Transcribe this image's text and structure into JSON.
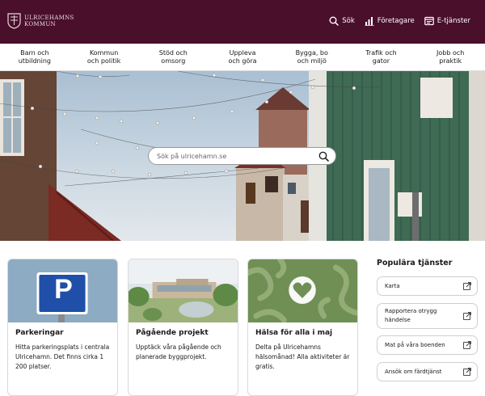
{
  "header": {
    "logo_line1": "ULRICEHAMNS",
    "logo_line2": "KOMMUN",
    "links": [
      {
        "label": "Sök",
        "icon": "search-icon"
      },
      {
        "label": "Företagare",
        "icon": "bar-chart-icon"
      },
      {
        "label": "E-tjänster",
        "icon": "e-services-icon"
      }
    ]
  },
  "nav": {
    "items": [
      {
        "line1": "Barn och",
        "line2": "utbildning"
      },
      {
        "line1": "Kommun",
        "line2": "och politik"
      },
      {
        "line1": "Stöd och",
        "line2": "omsorg"
      },
      {
        "line1": "Uppleva",
        "line2": "och göra"
      },
      {
        "line1": "Bygga, bo",
        "line2": "och miljö"
      },
      {
        "line1": "Trafik och",
        "line2": "gator"
      },
      {
        "line1": "Jobb och",
        "line2": "praktik"
      }
    ]
  },
  "hero": {
    "search_placeholder": "Sök på ulricehamn.se"
  },
  "cards": [
    {
      "title": "Parkeringar",
      "text": "Hitta parkeringsplats i centrala Ulricehamn. Det finns cirka 1 200 platser.",
      "sign_letter": "P"
    },
    {
      "title": "Pågående projekt",
      "text": "Upptäck våra pågående och planerade byggprojekt."
    },
    {
      "title": "Hälsa för alla i maj",
      "text": "Delta på Ulricehamns hälsomånad! Alla aktiviteter är gratis."
    }
  ],
  "popular": {
    "title": "Populära tjänster",
    "items": [
      {
        "label": "Karta"
      },
      {
        "label": "Rapportera otrygg händelse"
      },
      {
        "label": "Mat på våra boenden"
      },
      {
        "label": "Ansök om färdtjänst"
      }
    ]
  },
  "colors": {
    "brand": "#4a0f2a",
    "parking_sign": "#1f4fa8",
    "health_card": "#6f8f54"
  }
}
